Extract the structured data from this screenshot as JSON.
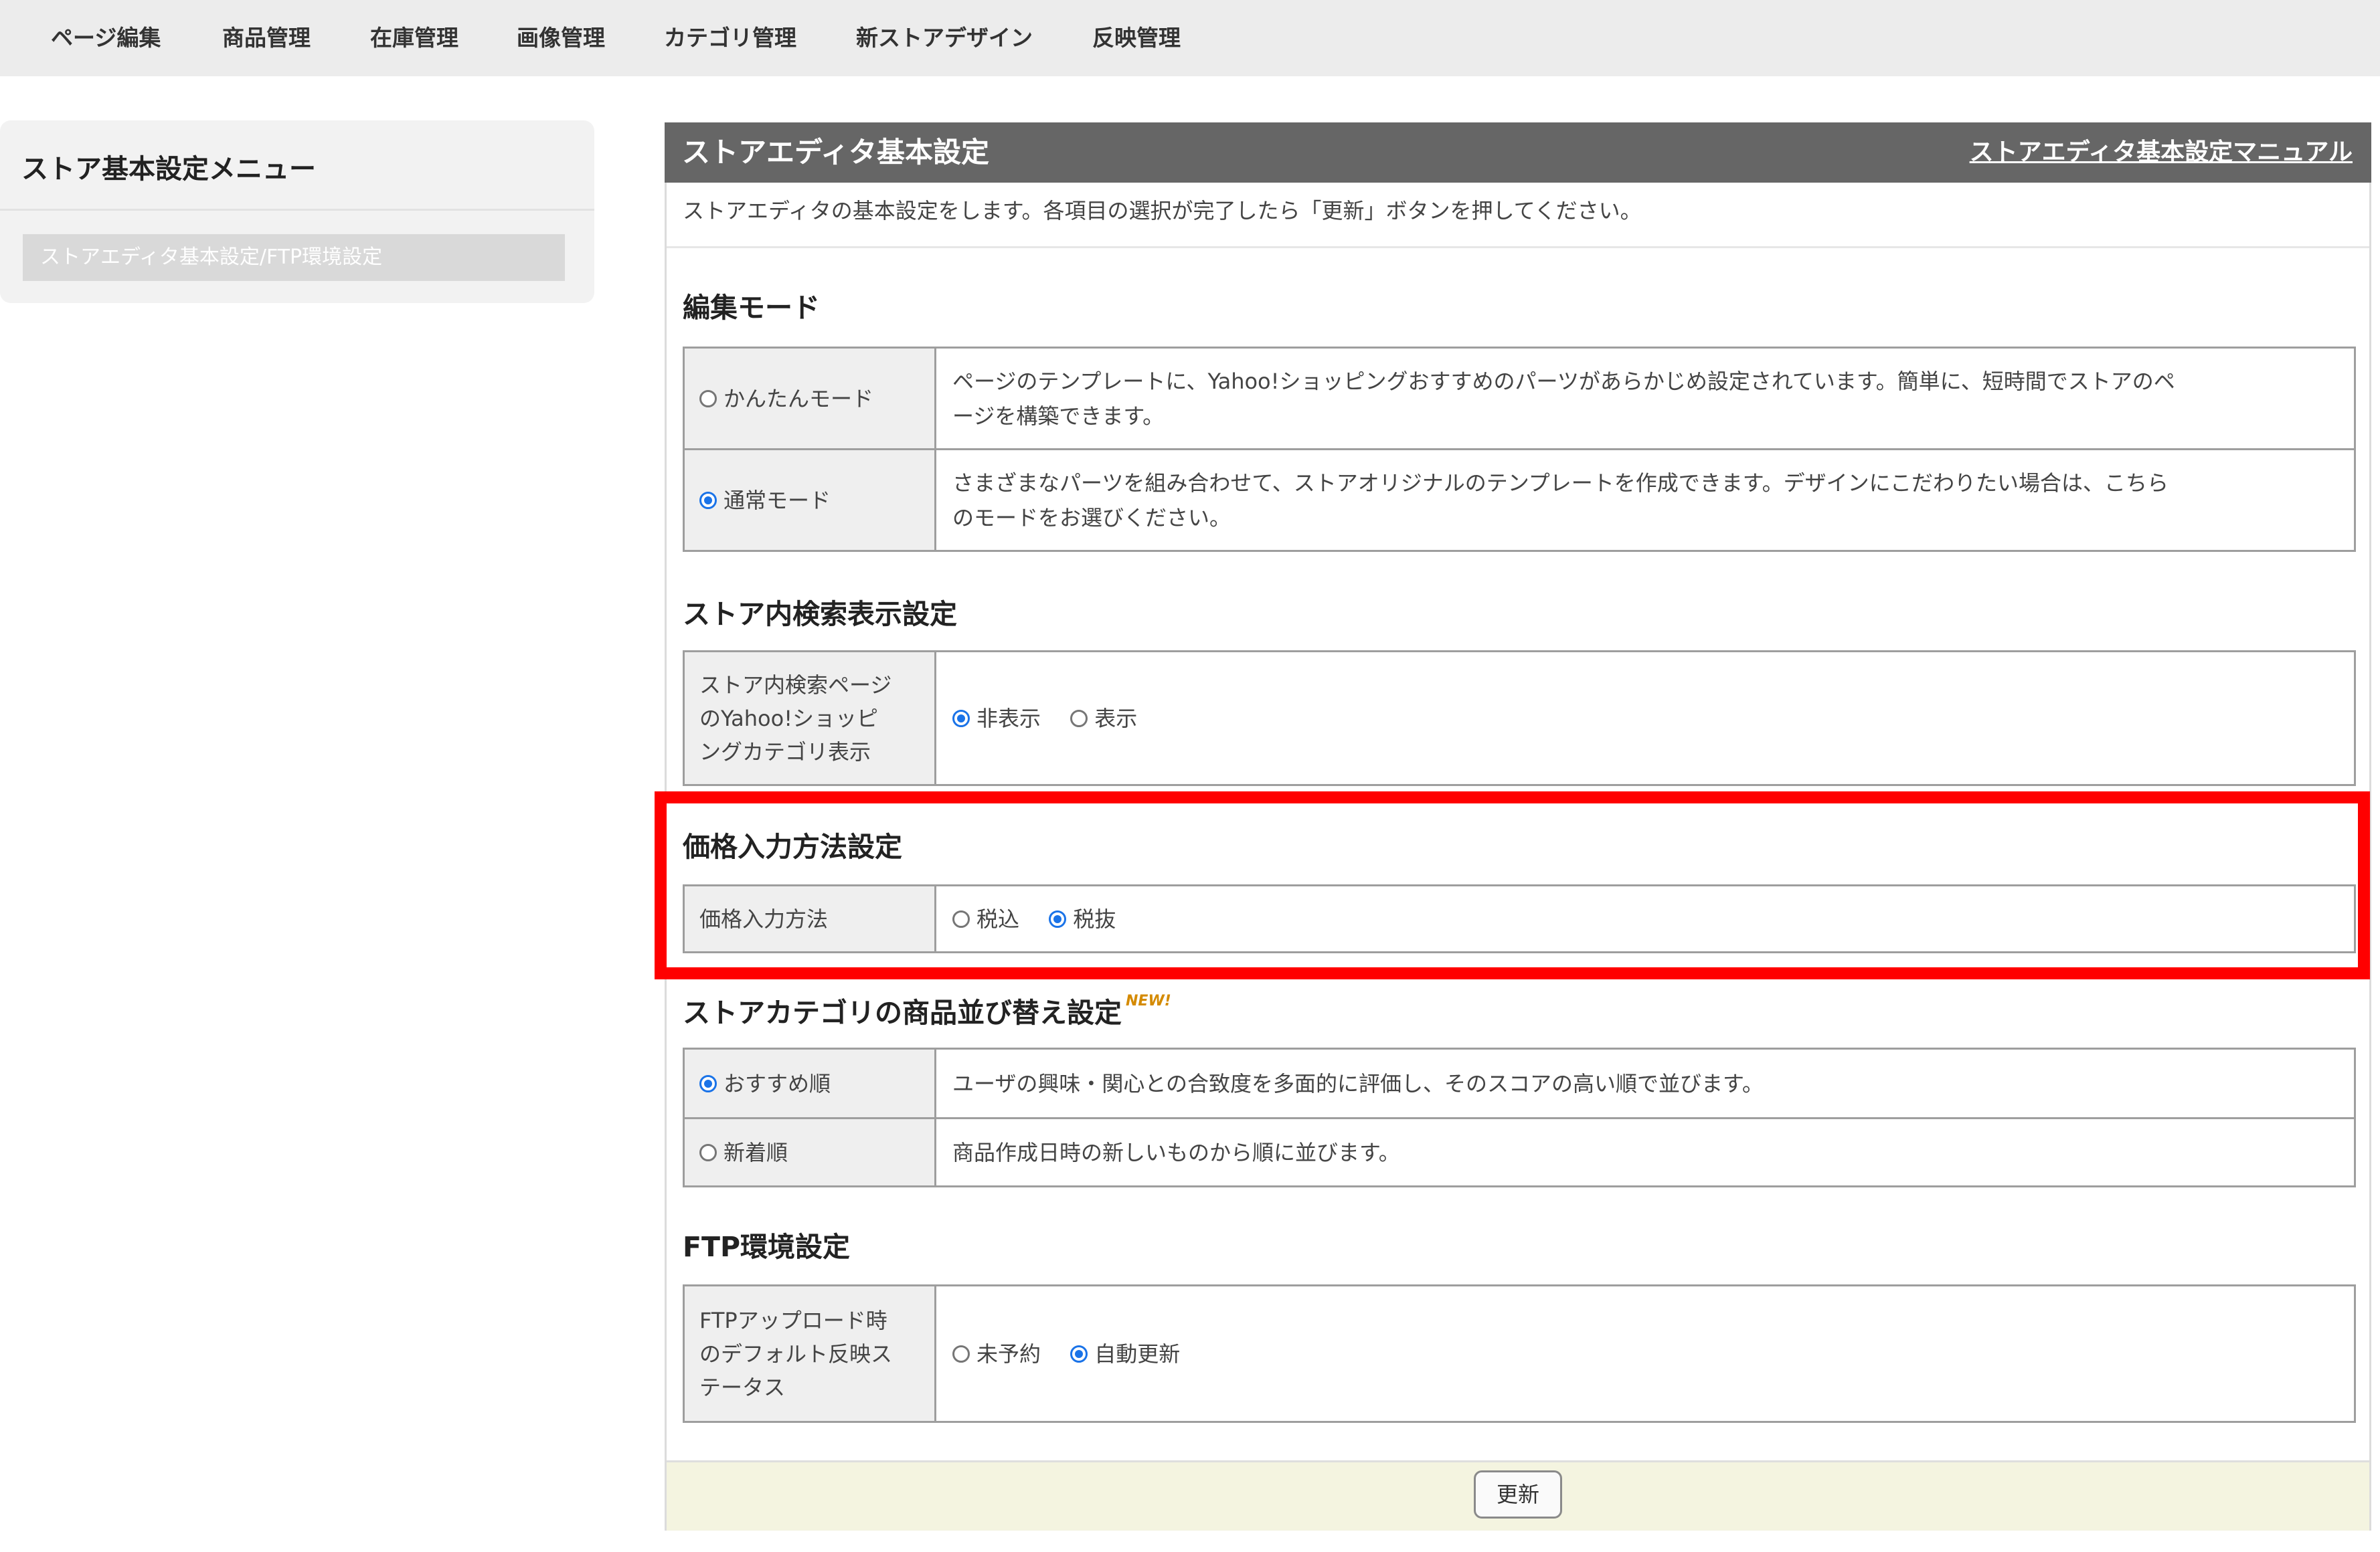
{
  "topnav": {
    "items": [
      "ページ編集",
      "商品管理",
      "在庫管理",
      "画像管理",
      "カテゴリ管理",
      "新ストアデザイン",
      "反映管理"
    ]
  },
  "sidebar": {
    "title": "ストア基本設定メニュー",
    "items": [
      {
        "label": "ストアエディタ基本設定/FTP環境設定",
        "active": true
      }
    ]
  },
  "panel": {
    "title": "ストアエディタ基本設定",
    "manual_link": "ストアエディタ基本設定マニュアル",
    "intro": "ストアエディタの基本設定をします。各項目の選択が完了したら「更新」ボタンを押してください。"
  },
  "edit_mode": {
    "heading": "編集モード",
    "rows": [
      {
        "label": "かんたんモード",
        "selected": false,
        "desc1": "ページのテンプレートに、Yahoo!ショッピングおすすめのパーツがあらかじめ設定されています。簡単に、短時間でストアのペ",
        "desc2": "ージを構築できます。"
      },
      {
        "label": "通常モード",
        "selected": true,
        "desc1": "さまざまなパーツを組み合わせて、ストアオリジナルのテンプレートを作成できます。デザインにこだわりたい場合は、こちら",
        "desc2": "のモードをお選びください。"
      }
    ]
  },
  "search_display": {
    "heading": "ストア内検索表示設定",
    "label_lines": [
      "ストア内検索ページ",
      "のYahoo!ショッピ",
      "ングカテゴリ表示"
    ],
    "options": [
      {
        "label": "非表示",
        "selected": true
      },
      {
        "label": "表示",
        "selected": false
      }
    ]
  },
  "price_input": {
    "heading": "価格入力方法設定",
    "label": "価格入力方法",
    "options": [
      {
        "label": "税込",
        "selected": false
      },
      {
        "label": "税抜",
        "selected": true
      }
    ]
  },
  "category_sort": {
    "heading": "ストアカテゴリの商品並び替え設定",
    "badge": "NEW!",
    "rows": [
      {
        "label": "おすすめ順",
        "selected": true,
        "desc": "ユーザの興味・関心との合致度を多面的に評価し、そのスコアの高い順で並びます。"
      },
      {
        "label": "新着順",
        "selected": false,
        "desc": "商品作成日時の新しいものから順に並びます。"
      }
    ]
  },
  "ftp": {
    "heading": "FTP環境設定",
    "label_lines": [
      "FTPアップロード時",
      "のデフォルト反映ス",
      "テータス"
    ],
    "options": [
      {
        "label": "未予約",
        "selected": false
      },
      {
        "label": "自動更新",
        "selected": true
      }
    ]
  },
  "footer": {
    "update_button": "更新"
  },
  "colors": {
    "header_bg": "#666666",
    "highlight": "#ff0000",
    "radio_selected": "#1a73e8",
    "footer_bg": "#f4f4e0"
  }
}
